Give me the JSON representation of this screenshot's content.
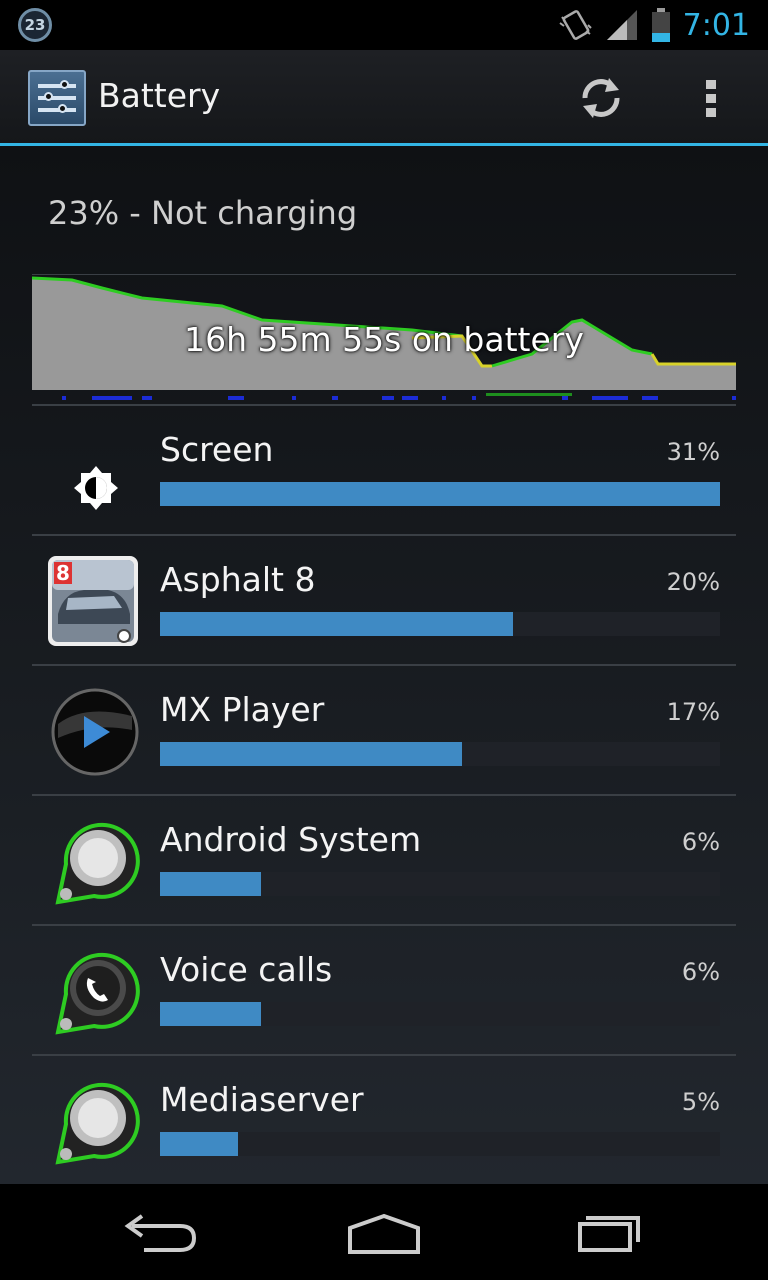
{
  "status_bar": {
    "notification_count": "23",
    "time": "7:01",
    "icons": [
      "vibrate-icon",
      "signal-icon",
      "battery-icon"
    ]
  },
  "action_bar": {
    "title": "Battery",
    "app_icon": "settings-sliders-icon",
    "refresh_icon": "refresh-icon",
    "overflow_icon": "overflow-menu-icon"
  },
  "battery": {
    "status": "23% - Not charging",
    "graph_label": "16h 55m 55s on battery"
  },
  "items": [
    {
      "name": "Screen",
      "percent": "31%",
      "value": 1.0,
      "icon": "brightness-icon"
    },
    {
      "name": "Asphalt 8",
      "percent": "20%",
      "value": 0.63,
      "icon": "asphalt-8-icon"
    },
    {
      "name": "MX Player",
      "percent": "17%",
      "value": 0.54,
      "icon": "mx-player-icon"
    },
    {
      "name": "Android System",
      "percent": "6%",
      "value": 0.18,
      "icon": "android-system-icon"
    },
    {
      "name": "Voice calls",
      "percent": "6%",
      "value": 0.18,
      "icon": "voice-calls-icon"
    },
    {
      "name": "Mediaserver",
      "percent": "5%",
      "value": 0.14,
      "icon": "mediaserver-icon"
    }
  ],
  "nav_bar": {
    "icons": [
      "back-icon",
      "home-icon",
      "recent-apps-icon"
    ]
  },
  "colors": {
    "accent": "#33b5e5",
    "bar_fill": "#3f8ac4",
    "graph_line_green": "#2ecc22",
    "graph_line_yellow": "#d8d22a"
  }
}
